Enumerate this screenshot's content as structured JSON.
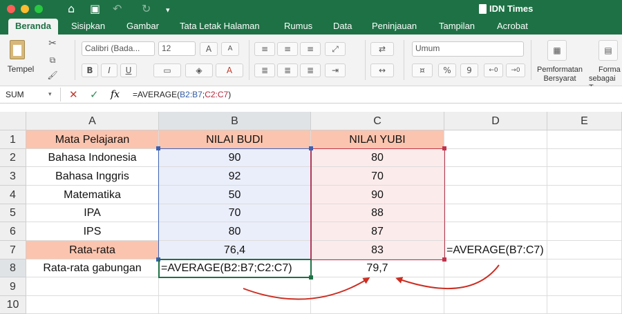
{
  "titlebar": {
    "app_title": "IDN Times",
    "icons": [
      "home-icon",
      "save-icon",
      "undo-icon",
      "redo-icon",
      "customize-icon"
    ]
  },
  "tabs": [
    {
      "label": "Beranda",
      "active": true
    },
    {
      "label": "Sisipkan"
    },
    {
      "label": "Gambar"
    },
    {
      "label": "Tata Letak Halaman"
    },
    {
      "label": "Rumus"
    },
    {
      "label": "Data"
    },
    {
      "label": "Peninjauan"
    },
    {
      "label": "Tampilan"
    },
    {
      "label": "Acrobat"
    }
  ],
  "ribbon": {
    "paste_label": "Tempel",
    "font_name": "Calibri (Bada...",
    "font_size": "12",
    "bold": "B",
    "italic": "I",
    "underline": "U",
    "number_format": "Umum",
    "percent": "%",
    "comma": "9",
    "cond_format_line1": "Pemformatan",
    "cond_format_line2": "Bersyarat",
    "format_table_line1": "Forma",
    "format_table_line2": "sebagai T"
  },
  "formula_bar": {
    "name_box": "SUM",
    "cancel": "✕",
    "enter": "✓",
    "fx": "fx",
    "formula_prefix": "=AVERAGE(",
    "ref1": "B2:B7",
    "sep": ";",
    "ref2": "C2:C7",
    "formula_suffix": ")"
  },
  "columns": [
    "A",
    "B",
    "C",
    "D",
    "E"
  ],
  "rows": [
    "1",
    "2",
    "3",
    "4",
    "5",
    "6",
    "7",
    "8",
    "9",
    "10"
  ],
  "sheet": {
    "A1": "Mata Pelajaran",
    "B1": "NILAI BUDI",
    "C1": "NILAI YUBI",
    "A2": "Bahasa Indonesia",
    "B2": "90",
    "C2": "80",
    "A3": "Bahasa Inggris",
    "B3": "92",
    "C3": "70",
    "A4": "Matematika",
    "B4": "50",
    "C4": "90",
    "A5": "IPA",
    "B5": "70",
    "C5": "88",
    "A6": "IPS",
    "B6": "80",
    "C6": "87",
    "A7": "Rata-rata",
    "B7": "76,4",
    "C7": "83",
    "D7": "=AVERAGE(B7:C7)",
    "A8": "Rata-rata gabungan",
    "B8": "=AVERAGE(B2:B7;C2:C7)",
    "C8": "79,7"
  },
  "colors": {
    "excel_green": "#1e7145",
    "header_fill": "#fbc4ae",
    "range_blue": "#3d61b3",
    "range_red": "#c0334b",
    "arrow_red": "#cc2e22"
  }
}
